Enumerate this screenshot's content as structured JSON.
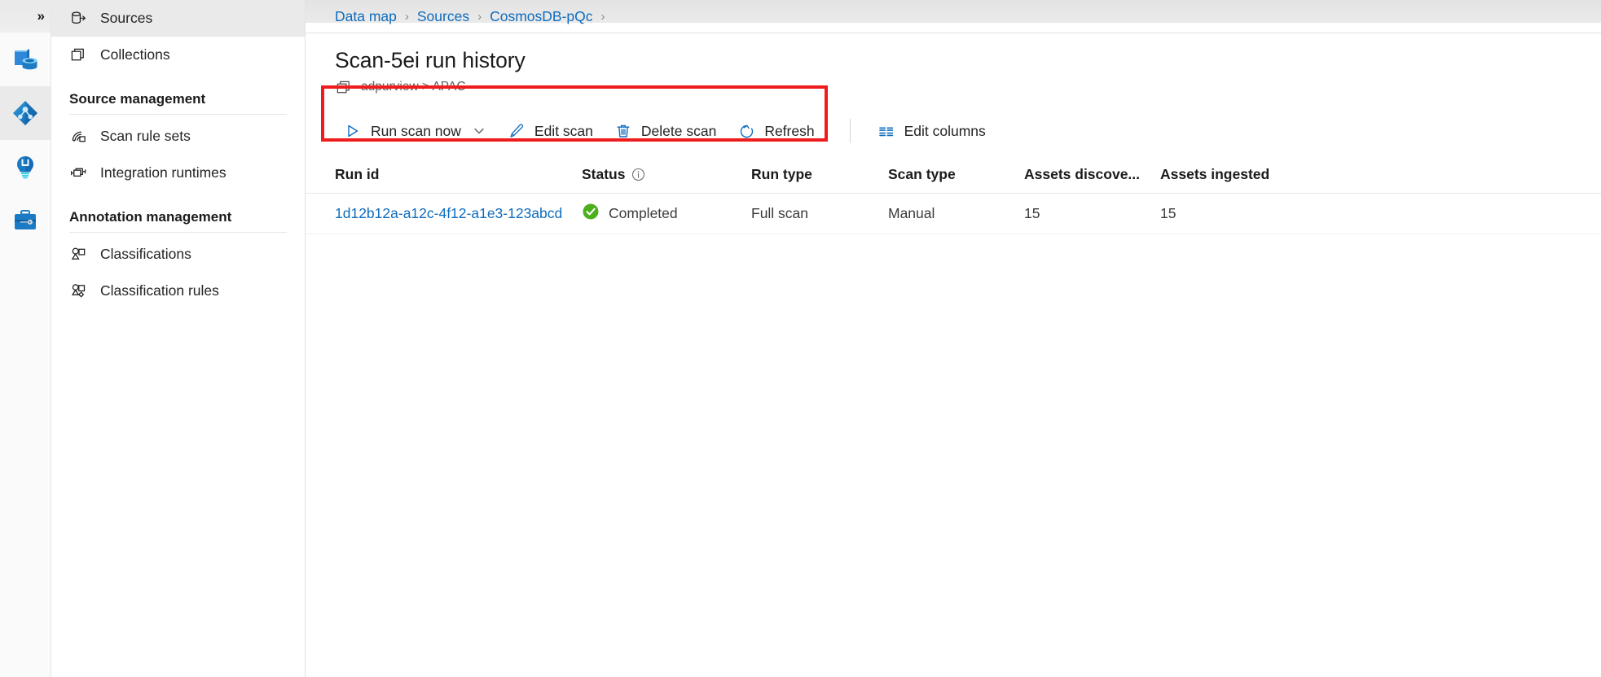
{
  "rail": {
    "expand_label": "»",
    "items": [
      {
        "name": "data-catalog",
        "title": "Data catalog",
        "active": false
      },
      {
        "name": "data-map",
        "title": "Data map",
        "active": true
      },
      {
        "name": "data-insights",
        "title": "Data insights",
        "active": false
      },
      {
        "name": "management",
        "title": "Management",
        "active": false
      }
    ]
  },
  "nav": {
    "items": [
      {
        "label": "Sources",
        "icon": "source-icon",
        "selected": true
      },
      {
        "label": "Collections",
        "icon": "collections-icon",
        "selected": false
      }
    ],
    "sections": [
      {
        "title": "Source management",
        "items": [
          {
            "label": "Scan rule sets",
            "icon": "scan-rule-sets-icon"
          },
          {
            "label": "Integration runtimes",
            "icon": "integration-runtimes-icon"
          }
        ]
      },
      {
        "title": "Annotation management",
        "items": [
          {
            "label": "Classifications",
            "icon": "classifications-icon"
          },
          {
            "label": "Classification rules",
            "icon": "classification-rules-icon"
          }
        ]
      }
    ]
  },
  "breadcrumb": {
    "items": [
      "Data map",
      "Sources",
      "CosmosDB-pQc"
    ],
    "separator": "›"
  },
  "page": {
    "title": "Scan-5ei run history",
    "subtitle": "adpurview > APAC",
    "subtitle_icon": "collection-icon"
  },
  "toolbar": {
    "run_scan_now": "Run scan now",
    "edit_scan": "Edit scan",
    "delete_scan": "Delete scan",
    "refresh": "Refresh",
    "edit_columns": "Edit columns",
    "highlight_color": "#ee1c1c"
  },
  "table": {
    "columns": [
      {
        "key": "run_id",
        "label": "Run id",
        "info": false
      },
      {
        "key": "status",
        "label": "Status",
        "info": true
      },
      {
        "key": "run_type",
        "label": "Run type",
        "info": false
      },
      {
        "key": "scan_type",
        "label": "Scan type",
        "info": false
      },
      {
        "key": "assets_discovered",
        "label": "Assets discove...",
        "info": false
      },
      {
        "key": "assets_ingested",
        "label": "Assets ingested",
        "info": false
      }
    ],
    "rows": [
      {
        "run_id": "1d12b12a-a12c-4f12-a1e3-123abcd",
        "status": "Completed",
        "status_color": "#4caf1e",
        "run_type": "Full scan",
        "scan_type": "Manual",
        "assets_discovered": "15",
        "assets_ingested": "15"
      }
    ]
  },
  "colors": {
    "accent": "#0f6cbd",
    "success": "#4caf1e",
    "highlight": "#ee1c1c"
  }
}
